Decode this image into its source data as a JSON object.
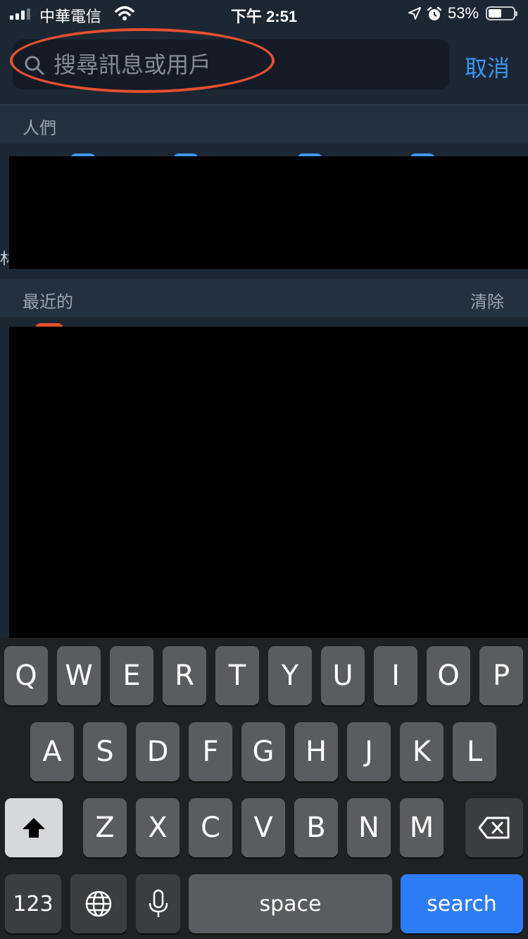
{
  "status_bar": {
    "carrier": "中華電信",
    "time": "下午 2:51",
    "battery_percent": "53%",
    "battery_level": 0.53,
    "icons": [
      "signal-icon",
      "wifi-icon",
      "location-icon",
      "alarm-icon",
      "battery-icon"
    ]
  },
  "search": {
    "placeholder": "搜尋訊息或用戶",
    "value": "",
    "cancel_label": "取消"
  },
  "sections": {
    "people": {
      "title": "人們"
    },
    "recent": {
      "title": "最近的",
      "action": "清除"
    }
  },
  "edge_char": "林",
  "keyboard": {
    "row1": [
      "Q",
      "W",
      "E",
      "R",
      "T",
      "Y",
      "U",
      "I",
      "O",
      "P"
    ],
    "row2": [
      "A",
      "S",
      "D",
      "F",
      "G",
      "H",
      "J",
      "K",
      "L"
    ],
    "row3": [
      "Z",
      "X",
      "C",
      "V",
      "B",
      "N",
      "M"
    ],
    "numbers_label": "123",
    "space_label": "space",
    "search_label": "search"
  },
  "colors": {
    "background": "#1c2734",
    "accent": "#3d95f2",
    "annotation": "#e5502e",
    "search_key": "#2e7cf6"
  }
}
